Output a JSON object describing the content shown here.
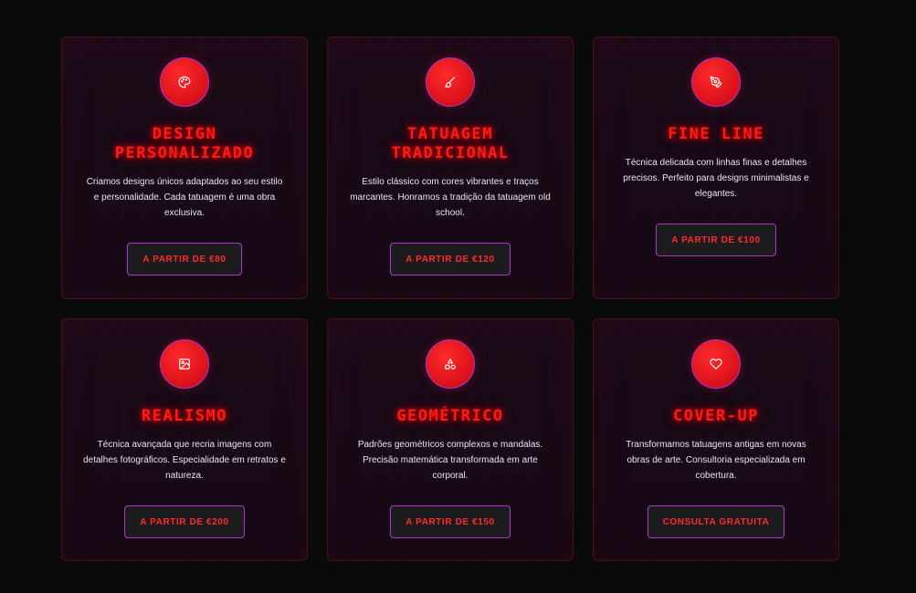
{
  "cards": [
    {
      "icon": "palette-icon",
      "title": "DESIGN PERSONALIZADO",
      "description": "Criamos designs únicos adaptados ao seu estilo e personalidade. Cada tatuagem é uma obra exclusiva.",
      "button": "A PARTIR DE €80"
    },
    {
      "icon": "brush-icon",
      "title": "TATUAGEM TRADICIONAL",
      "description": "Estilo clássico com cores vibrantes e traços marcantes. Honramos a tradição da tatuagem old school.",
      "button": "A PARTIR DE €120"
    },
    {
      "icon": "pen-nib-icon",
      "title": "FINE LINE",
      "description": "Técnica delicada com linhas finas e detalhes precisos. Perfeito para designs minimalistas e elegantes.",
      "button": "A PARTIR DE €100"
    },
    {
      "icon": "image-icon",
      "title": "REALISMO",
      "description": "Técnica avançada que recria imagens com detalhes fotográficos. Especialidade em retratos e natureza.",
      "button": "A PARTIR DE €200"
    },
    {
      "icon": "shapes-icon",
      "title": "GEOMÉTRICO",
      "description": "Padrões geométricos complexos e mandalas. Precisão matemática transformada em arte corporal.",
      "button": "A PARTIR DE €150"
    },
    {
      "icon": "heart-icon",
      "title": "COVER-UP",
      "description": "Transformamos tatuagens antigas em novas obras de arte. Consultoria especializada em cobertura.",
      "button": "CONSULTA GRATUITA"
    }
  ],
  "colors": {
    "accent": "#ff1a1a",
    "button_border": "#b034c8",
    "page_background": "#0a0a0a"
  }
}
